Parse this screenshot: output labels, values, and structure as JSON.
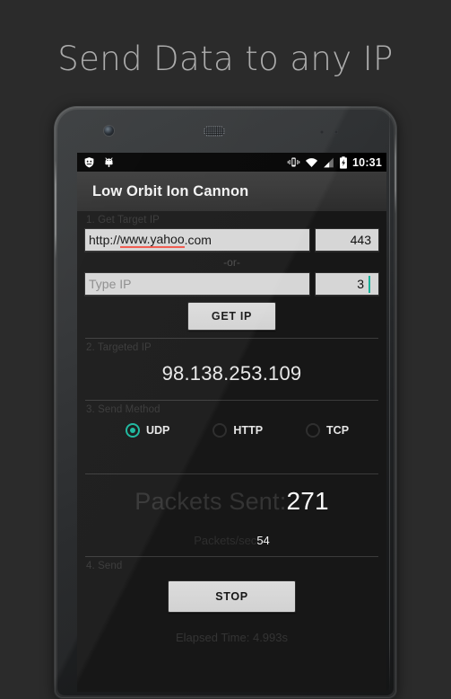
{
  "promo": {
    "headline": "Send Data to any IP"
  },
  "phone": {
    "hardware": {
      "camera": "front-camera",
      "speaker": "earpiece-speaker",
      "sensors": "proximity-sensors"
    }
  },
  "statusbar": {
    "notifications": [
      "shield-notification-icon",
      "android-notification-icon"
    ],
    "icons": [
      "vibrate-icon",
      "wifi-icon",
      "cell-signal-icon",
      "battery-charging-icon"
    ],
    "time": "10:31"
  },
  "actionbar": {
    "title": "Low Orbit Ion Cannon"
  },
  "sections": {
    "step1": {
      "label": "1. Get Target IP",
      "url_field": {
        "value_prefix": "http://",
        "value_misspelled": "www.yahoo",
        "value_suffix": ".com",
        "full_value": "http://www.yahoo.com"
      },
      "port_field": {
        "value": "443"
      },
      "or_text": "-or-",
      "ip_field": {
        "value": "",
        "placeholder": "Type IP"
      },
      "ip_port_field": {
        "value": "3"
      },
      "get_ip_button": "GET IP"
    },
    "step2": {
      "label": "2. Targeted IP",
      "ip_value": "98.138.253.109"
    },
    "step3": {
      "label": "3. Send Method",
      "options": [
        {
          "label": "UDP",
          "selected": true
        },
        {
          "label": "HTTP",
          "selected": false
        },
        {
          "label": "TCP",
          "selected": false
        }
      ]
    },
    "stats": {
      "packets_sent_label": "Packets Sent:",
      "packets_sent_value": "271",
      "packets_per_sec_label": "Packets/sec",
      "packets_per_sec_value": "54"
    },
    "step4": {
      "label": "4. Send",
      "stop_button": "STOP",
      "elapsed_time": "Elapsed Time: 4.993s"
    }
  },
  "colors": {
    "accent_teal": "#19b79a",
    "spellcheck_red": "#f0564a",
    "page_background": "#2b2b2b",
    "screen_background": "#171717"
  }
}
